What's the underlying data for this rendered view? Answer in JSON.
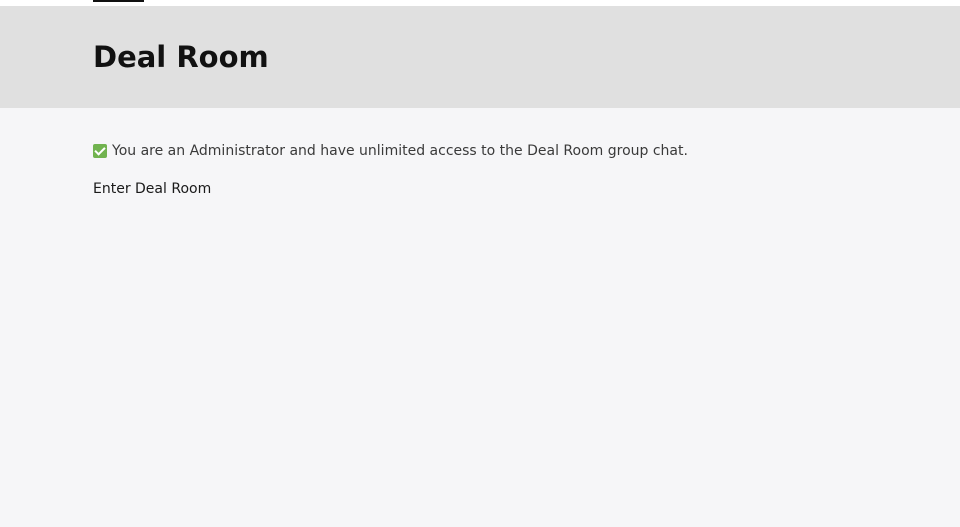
{
  "header": {
    "title": "Deal Room"
  },
  "access_notice": {
    "icon": "check-box-icon",
    "text": "You are an Administrator and have unlimited access to the Deal Room group chat."
  },
  "actions": {
    "enter_label": "Enter Deal Room"
  },
  "colors": {
    "header_background": "#e0e0e0",
    "page_background": "#f6f6f8",
    "check_icon": "#71b34f"
  }
}
